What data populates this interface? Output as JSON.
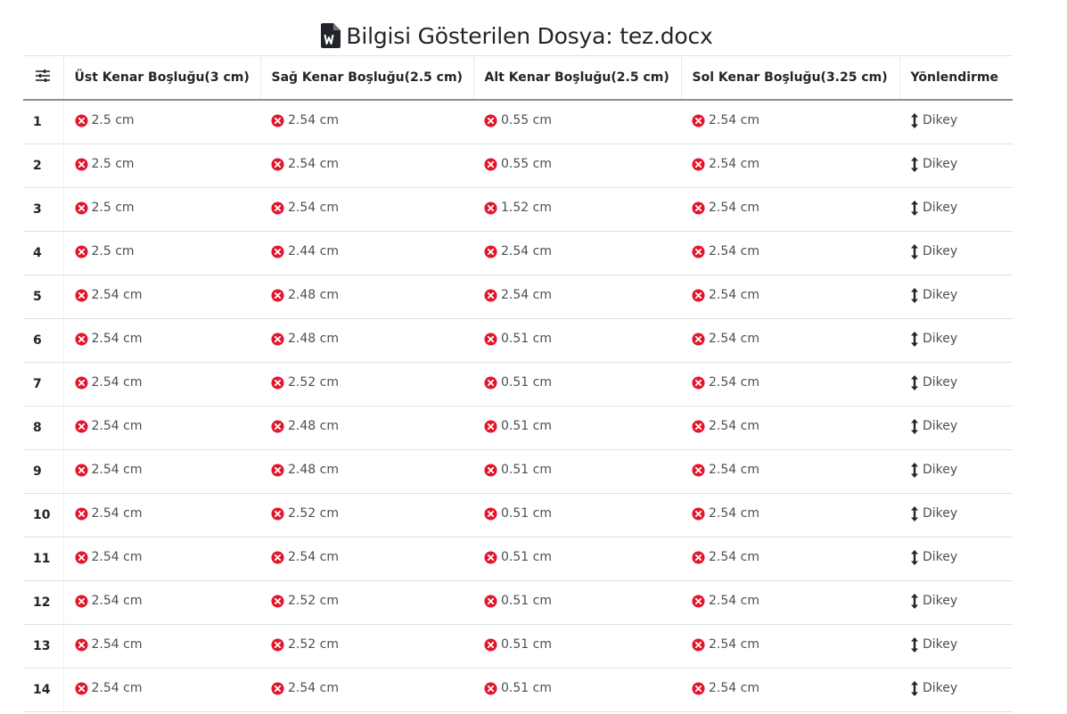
{
  "title": {
    "text": "Bilgisi Gösterilen Dosya: tez.docx",
    "icon": "word-document-icon"
  },
  "table": {
    "settings_icon": "column-settings-icon",
    "columns": [
      "Üst Kenar Boşluğu(3 cm)",
      "Sağ Kenar Boşluğu(2.5 cm)",
      "Alt Kenar Boşluğu(2.5 cm)",
      "Sol Kenar Boşluğu(3.25 cm)",
      "Yönlendirme"
    ],
    "status_icon": "error-circle-icon",
    "status_color": "#e3152b",
    "orientation_icon": "vertical-arrows-icon",
    "rows": [
      {
        "n": "1",
        "top": "2.5 cm",
        "right": "2.54 cm",
        "bottom": "0.55 cm",
        "left": "2.54 cm",
        "orientation": "Dikey"
      },
      {
        "n": "2",
        "top": "2.5 cm",
        "right": "2.54 cm",
        "bottom": "0.55 cm",
        "left": "2.54 cm",
        "orientation": "Dikey"
      },
      {
        "n": "3",
        "top": "2.5 cm",
        "right": "2.54 cm",
        "bottom": "1.52 cm",
        "left": "2.54 cm",
        "orientation": "Dikey"
      },
      {
        "n": "4",
        "top": "2.5 cm",
        "right": "2.44 cm",
        "bottom": "2.54 cm",
        "left": "2.54 cm",
        "orientation": "Dikey"
      },
      {
        "n": "5",
        "top": "2.54 cm",
        "right": "2.48 cm",
        "bottom": "2.54 cm",
        "left": "2.54 cm",
        "orientation": "Dikey"
      },
      {
        "n": "6",
        "top": "2.54 cm",
        "right": "2.48 cm",
        "bottom": "0.51 cm",
        "left": "2.54 cm",
        "orientation": "Dikey"
      },
      {
        "n": "7",
        "top": "2.54 cm",
        "right": "2.52 cm",
        "bottom": "0.51 cm",
        "left": "2.54 cm",
        "orientation": "Dikey"
      },
      {
        "n": "8",
        "top": "2.54 cm",
        "right": "2.48 cm",
        "bottom": "0.51 cm",
        "left": "2.54 cm",
        "orientation": "Dikey"
      },
      {
        "n": "9",
        "top": "2.54 cm",
        "right": "2.48 cm",
        "bottom": "0.51 cm",
        "left": "2.54 cm",
        "orientation": "Dikey"
      },
      {
        "n": "10",
        "top": "2.54 cm",
        "right": "2.52 cm",
        "bottom": "0.51 cm",
        "left": "2.54 cm",
        "orientation": "Dikey"
      },
      {
        "n": "11",
        "top": "2.54 cm",
        "right": "2.54 cm",
        "bottom": "0.51 cm",
        "left": "2.54 cm",
        "orientation": "Dikey"
      },
      {
        "n": "12",
        "top": "2.54 cm",
        "right": "2.52 cm",
        "bottom": "0.51 cm",
        "left": "2.54 cm",
        "orientation": "Dikey"
      },
      {
        "n": "13",
        "top": "2.54 cm",
        "right": "2.52 cm",
        "bottom": "0.51 cm",
        "left": "2.54 cm",
        "orientation": "Dikey"
      },
      {
        "n": "14",
        "top": "2.54 cm",
        "right": "2.54 cm",
        "bottom": "0.51 cm",
        "left": "2.54 cm",
        "orientation": "Dikey"
      }
    ]
  }
}
